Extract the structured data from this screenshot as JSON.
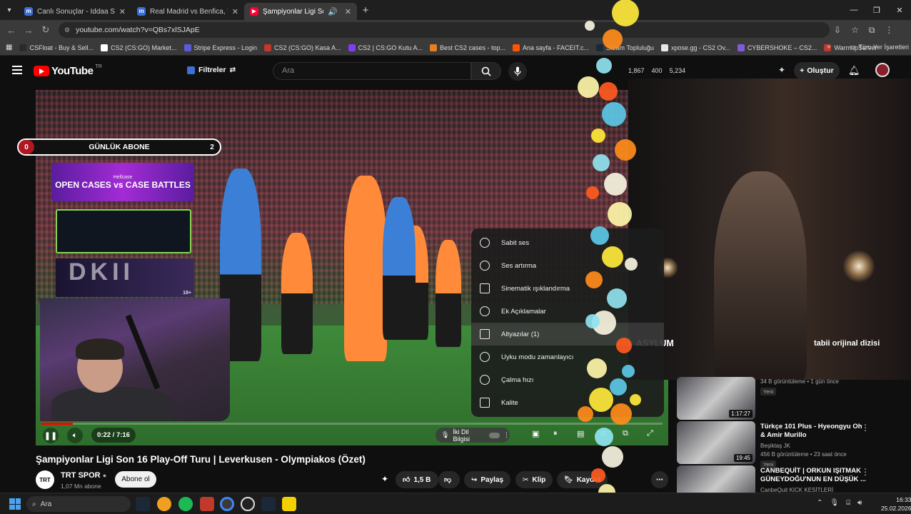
{
  "browser": {
    "tabs": [
      {
        "title": "Canlı Sonuçlar - İddaa Sonuçla...",
        "fav": "m"
      },
      {
        "title": "Real Madrid vs Benfica, Takım F...",
        "fav": "m"
      },
      {
        "title": "Şampiyonlar Ligi Son 16 Pl...",
        "fav": "yt",
        "active": true
      }
    ],
    "url": "youtube.com/watch?v=QBs7xlSJApE",
    "bookmarks": [
      {
        "label": "CSFloat - Buy & Sell...",
        "color": "#2b2b2b"
      },
      {
        "label": "CS2 (CS:GO) Market...",
        "color": "#ffffff"
      },
      {
        "label": "Stripe Express - Login",
        "color": "#5b5bd6"
      },
      {
        "label": "CS2 (CS:GO) Kasa A...",
        "color": "#c0392b"
      },
      {
        "label": "CS2 | CS:GO Kutu A...",
        "color": "#7e3ff2"
      },
      {
        "label": "Best CS2 cases - top...",
        "color": "#e67e22"
      },
      {
        "label": "Ana sayfa - FACEIT.c...",
        "color": "#ff5500"
      },
      {
        "label": "Steam Topluluğu",
        "color": "#1b2838"
      },
      {
        "label": "xpose.gg - CS2 Ov...",
        "color": "#e8e8e8"
      },
      {
        "label": "CYBERSHOKE – CS2...",
        "color": "#7f5bd6"
      },
      {
        "label": "WarmupServer",
        "color": "#c0392b"
      }
    ],
    "bookmarks_all": "Tüm Yer İşaretleri"
  },
  "youtube": {
    "logo": "YouTube",
    "region": "TR",
    "filters": "Filtreler",
    "search_placeholder": "Ara",
    "stats": [
      "1,867",
      "400",
      "5,234"
    ],
    "create": "Oluştur"
  },
  "overlay": {
    "daily_subs_label": "GÜNLÜK ABONE",
    "daily_subs_left": "0",
    "daily_subs_right": "2",
    "promo_brand": "Hellcase",
    "promo_text": "OPEN CASES vs CASE BATTLES",
    "dkii": "DKII",
    "age": "18+"
  },
  "settings_menu": [
    {
      "label": "Sabit ses",
      "icon": "stable-volume-icon"
    },
    {
      "label": "Ses artırma",
      "icon": "volume-boost-icon"
    },
    {
      "label": "Sinematik ışıklandırma",
      "icon": "ambient-mode-icon"
    },
    {
      "label": "Ek Açıklamalar",
      "icon": "annotations-icon"
    },
    {
      "label": "Altyazılar (1)",
      "icon": "subtitles-icon"
    },
    {
      "label": "Uyku modu zamanlayıcı",
      "icon": "sleep-timer-icon"
    },
    {
      "label": "Çalma hızı",
      "icon": "playback-speed-icon"
    },
    {
      "label": "Kalite",
      "icon": "quality-icon"
    }
  ],
  "player": {
    "time": "0:22 / 7:16",
    "progress": 0.05,
    "dub_label": "İki Dil Bilgisi"
  },
  "video": {
    "title": "Şampiyonlar Ligi Son 16 Play-Off Turu | Leverkusen - Olympiakos (Özet)",
    "channel": "TRT SPOR",
    "channel_avatar": "TRT",
    "subscribers": "1,07 Mn abone",
    "subscribe": "Abone ol",
    "likes": "1,5 B",
    "share": "Paylaş",
    "clip": "Klip",
    "save": "Kaydet"
  },
  "side_promo": {
    "title": "ASYLUM",
    "brand": "tabii orijinal dizisi"
  },
  "recommendations": [
    {
      "title": "",
      "channel": "",
      "meta": "34 B görüntüleme • 1 gün önce",
      "badge": "Yeni",
      "duration": "1:17:27"
    },
    {
      "title": "Türkçe 101 Plus - Hyeongyu Oh & Amir Murillo",
      "channel": "Beşiktaş JK",
      "meta": "456 B görüntüleme • 23 saat önce",
      "badge": "Yeni",
      "duration": "19:45"
    },
    {
      "title": "CANBEQUİT | ORKUN IŞITMAK GÜNEYDOĞU'NUN EN DÜŞÜK ...",
      "channel": "CanbeQuit KICK KESİTLERİ",
      "meta": "",
      "badge": "",
      "duration": ""
    }
  ],
  "taskbar": {
    "search": "Ara",
    "time": "16:33",
    "date": "25.02.2026"
  }
}
